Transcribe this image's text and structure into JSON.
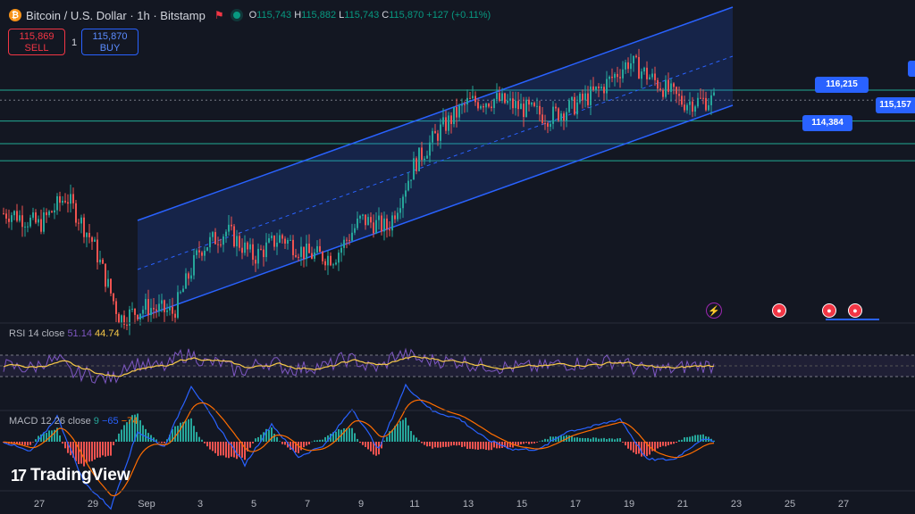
{
  "header": {
    "symbol_icon": "bitcoin-icon",
    "title": "Bitcoin / U.S. Dollar · 1h · Bitstamp",
    "ohlc": {
      "o_label": "O",
      "o": "115,743",
      "h_label": "H",
      "h": "115,882",
      "l_label": "L",
      "l": "115,743",
      "c_label": "C",
      "c": "115,870",
      "change": "+127 (+0.11%)"
    }
  },
  "trade": {
    "sell_price": "115,869",
    "sell_label": "SELL",
    "spread": "1",
    "buy_price": "115,870",
    "buy_label": "BUY"
  },
  "rsi": {
    "name": "RSI 14 close",
    "value1": "51.14",
    "value2": "44.74",
    "ylim": [
      0,
      100
    ],
    "overbought": 70,
    "oversold": 30
  },
  "macd": {
    "name": "MACD 12 26 close",
    "value1": "9",
    "value2": "−65",
    "value3": "−74"
  },
  "x_ticks": [
    "27",
    "29",
    "Sep",
    "3",
    "5",
    "7",
    "9",
    "11",
    "13",
    "15",
    "17",
    "19",
    "21",
    "23",
    "25",
    "27"
  ],
  "price_tags": [
    "116,215",
    "114,384",
    "115,157"
  ],
  "logo_text": "TradingView",
  "colors": {
    "up": "#26a69a",
    "down": "#ef5350",
    "channel": "#2962ff",
    "rsi": "#7e57c2",
    "rsi_ma": "#f7c948",
    "macd": "#2962ff",
    "signal": "#ff6d00"
  },
  "chart_data": [
    {
      "type": "candlestick",
      "title": "Bitcoin / U.S. Dollar · 1h · Bitstamp",
      "x_start": "2025-08-26",
      "x_end": "2025-08-27 (next month)",
      "price_levels": [
        116215,
        114384,
        115157
      ],
      "close_series_keypoints": [
        {
          "x": "Aug 26",
          "y": 112000
        },
        {
          "x": "Aug 27",
          "y": 111600
        },
        {
          "x": "Aug 28",
          "y": 112600
        },
        {
          "x": "Aug 29",
          "y": 111000
        },
        {
          "x": "Aug 30",
          "y": 108400
        },
        {
          "x": "Aug 31",
          "y": 108800
        },
        {
          "x": "Sep 1",
          "y": 108600
        },
        {
          "x": "Sep 2",
          "y": 110800
        },
        {
          "x": "Sep 3",
          "y": 111400
        },
        {
          "x": "Sep 4",
          "y": 110500
        },
        {
          "x": "Sep 5",
          "y": 111200
        },
        {
          "x": "Sep 6",
          "y": 110600
        },
        {
          "x": "Sep 7",
          "y": 110500
        },
        {
          "x": "Sep 8",
          "y": 111800
        },
        {
          "x": "Sep 9",
          "y": 111500
        },
        {
          "x": "Sep 10",
          "y": 113700
        },
        {
          "x": "Sep 11",
          "y": 114900
        },
        {
          "x": "Sep 12",
          "y": 115800
        },
        {
          "x": "Sep 13",
          "y": 115900
        },
        {
          "x": "Sep 14",
          "y": 115600
        },
        {
          "x": "Sep 15",
          "y": 115300
        },
        {
          "x": "Sep 16",
          "y": 115700
        },
        {
          "x": "Sep 17",
          "y": 116300
        },
        {
          "x": "Sep 18",
          "y": 117200
        },
        {
          "x": "Sep 19",
          "y": 116500
        },
        {
          "x": "Sep 20",
          "y": 115800
        },
        {
          "x": "Sep 21",
          "y": 115870
        }
      ]
    },
    {
      "type": "line",
      "title": "RSI 14 close",
      "ylim": [
        0,
        100
      ],
      "series": [
        {
          "name": "RSI",
          "last": 51.14
        },
        {
          "name": "RSI MA",
          "last": 44.74
        }
      ]
    },
    {
      "type": "bar",
      "title": "MACD 12 26 close",
      "series": [
        {
          "name": "Histogram",
          "last": 9
        },
        {
          "name": "MACD",
          "last": -65
        },
        {
          "name": "Signal",
          "last": -74
        }
      ]
    }
  ]
}
